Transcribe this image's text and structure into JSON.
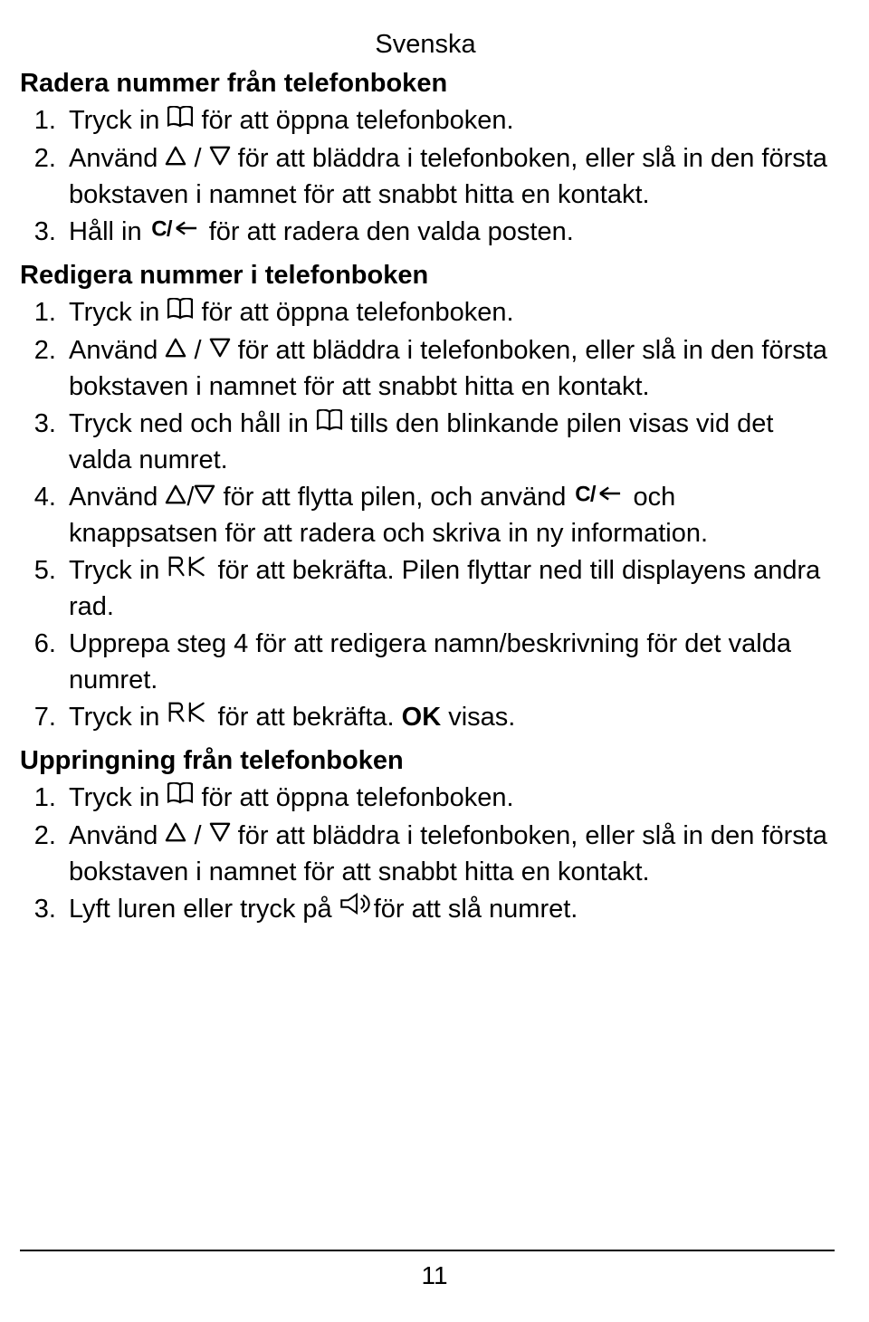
{
  "header": "Svenska",
  "page_number": "11",
  "sections": {
    "s1": {
      "title": "Radera nummer från telefonboken",
      "i1a": "Tryck in ",
      "i1b": " för att öppna telefonboken.",
      "i2a": "Använd ",
      "i2b": " / ",
      "i2c": " för att bläddra i telefonboken, eller slå in den första bokstaven i namnet för att snabbt hitta en kontakt.",
      "i3a": "Håll in ",
      "i3b": " för att radera den valda posten."
    },
    "s2": {
      "title": "Redigera nummer i telefonboken",
      "i1a": "Tryck in ",
      "i1b": " för att öppna telefonboken.",
      "i2a": "Använd ",
      "i2b": " / ",
      "i2c": " för att bläddra i telefonboken, eller slå in den första bokstaven i namnet för att snabbt hitta en kontakt.",
      "i3a": "Tryck ned och håll in ",
      "i3b": " tills den blinkande pilen visas vid det valda numret.",
      "i4a": "Använd ",
      "i4b": "/",
      "i4c": " för att flytta pilen, och använd ",
      "i4d": " och knappsatsen för att radera och skriva in ny information.",
      "i5a": "Tryck in ",
      "i5b": " för att bekräfta. Pilen flyttar ned till displayens andra rad.",
      "i6": "Upprepa steg 4 för att redigera namn/beskrivning för det valda numret.",
      "i7a": "Tryck in ",
      "i7b": " för att bekräfta. ",
      "i7c": "OK",
      "i7d": " visas."
    },
    "s3": {
      "title": "Uppringning från telefonboken",
      "i1a": "Tryck in ",
      "i1b": " för att öppna telefonboken.",
      "i2a": "Använd ",
      "i2b": " / ",
      "i2c": " för att bläddra i telefonboken, eller slå in den första bokstaven i namnet för att snabbt hitta en kontakt.",
      "i3a": "Lyft luren eller tryck på ",
      "i3b": "för att slå numret."
    }
  }
}
